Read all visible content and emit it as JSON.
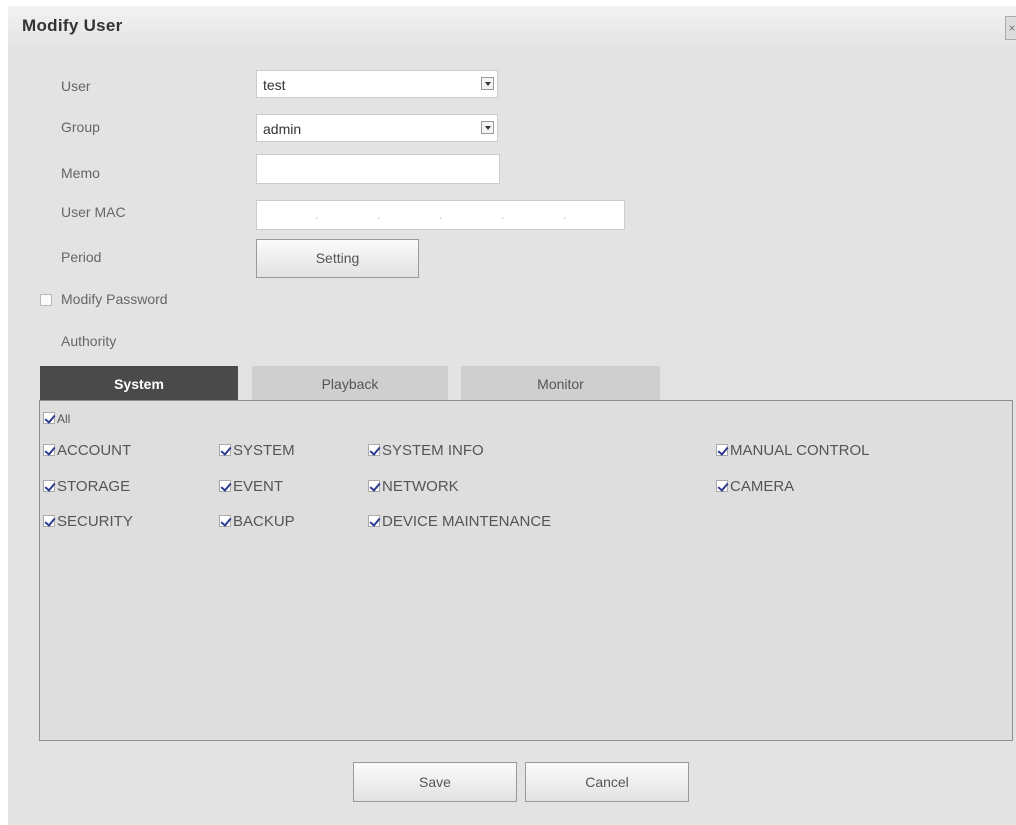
{
  "dialog": {
    "title": "Modify User",
    "close_icon": "close-icon"
  },
  "form": {
    "user_label": "User",
    "user_value": "test",
    "group_label": "Group",
    "group_value": "admin",
    "memo_label": "Memo",
    "memo_value": "",
    "user_mac_label": "User MAC",
    "user_mac_value": "",
    "period_label": "Period",
    "period_button": "Setting",
    "modify_password_label": "Modify Password",
    "modify_password_checked": false,
    "authority_label": "Authority"
  },
  "tabs": [
    {
      "label": "System",
      "active": true
    },
    {
      "label": "Playback",
      "active": false
    },
    {
      "label": "Monitor",
      "active": false
    }
  ],
  "permissions": {
    "all_label": "All",
    "items": [
      {
        "label": "ACCOUNT",
        "checked": true
      },
      {
        "label": "SYSTEM",
        "checked": true
      },
      {
        "label": "SYSTEM INFO",
        "checked": true
      },
      {
        "label": "MANUAL CONTROL",
        "checked": true
      },
      {
        "label": "STORAGE",
        "checked": true
      },
      {
        "label": "EVENT",
        "checked": true
      },
      {
        "label": "NETWORK",
        "checked": true
      },
      {
        "label": "CAMERA",
        "checked": true
      },
      {
        "label": "SECURITY",
        "checked": true
      },
      {
        "label": "BACKUP",
        "checked": true
      },
      {
        "label": "DEVICE MAINTENANCE",
        "checked": true
      }
    ]
  },
  "footer": {
    "save_label": "Save",
    "cancel_label": "Cancel"
  },
  "colors": {
    "dialog_bg": "#e3e3e3",
    "active_tab": "#4a4a4a",
    "inactive_tab": "#cfcfcf",
    "checkmark": "#2c3a8f"
  }
}
